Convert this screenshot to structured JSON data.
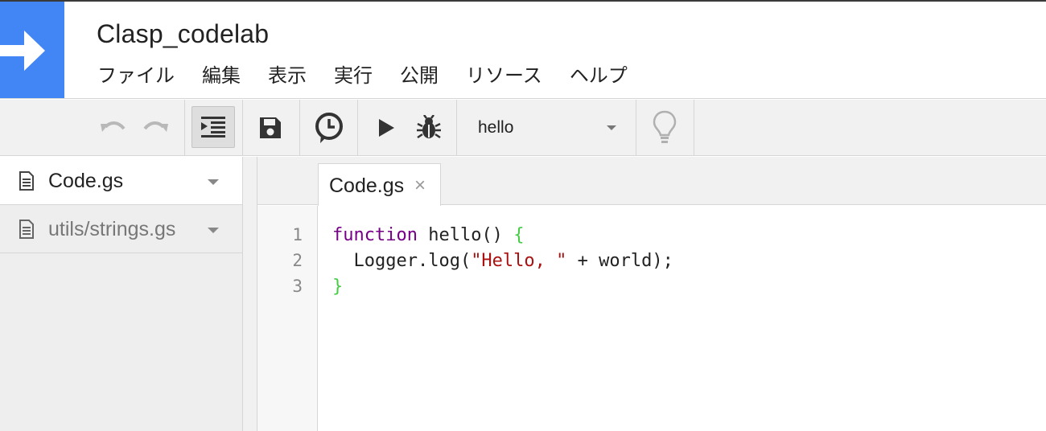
{
  "app": {
    "title": "Clasp_codelab"
  },
  "menu": [
    {
      "label": "ファイル"
    },
    {
      "label": "編集"
    },
    {
      "label": "表示"
    },
    {
      "label": "実行"
    },
    {
      "label": "公開"
    },
    {
      "label": "リソース"
    },
    {
      "label": "ヘルプ"
    }
  ],
  "toolbar": {
    "function_select": "hello",
    "icons": [
      "undo-icon",
      "redo-icon",
      "indent-icon",
      "save-icon",
      "triggers-clock-icon",
      "run-icon",
      "debug-bug-icon",
      "lightbulb-icon"
    ]
  },
  "files": [
    {
      "name": "Code.gs",
      "active": true
    },
    {
      "name": "utils/strings.gs",
      "active": false
    }
  ],
  "editor": {
    "tab_label": "Code.gs",
    "tab_close": "×",
    "line_numbers": [
      "1",
      "2",
      "3"
    ],
    "lines": {
      "l1": {
        "kw": "function",
        "rest": " hello() ",
        "brace": "{"
      },
      "l2": {
        "pre": "  Logger.log(",
        "str": "\"Hello, \"",
        "post": " + world);"
      },
      "l3": {
        "brace": "}"
      }
    }
  },
  "colors": {
    "brand": "#4285f4",
    "keyword": "#770088",
    "string": "#aa1111",
    "bracket": "#44cc44"
  }
}
